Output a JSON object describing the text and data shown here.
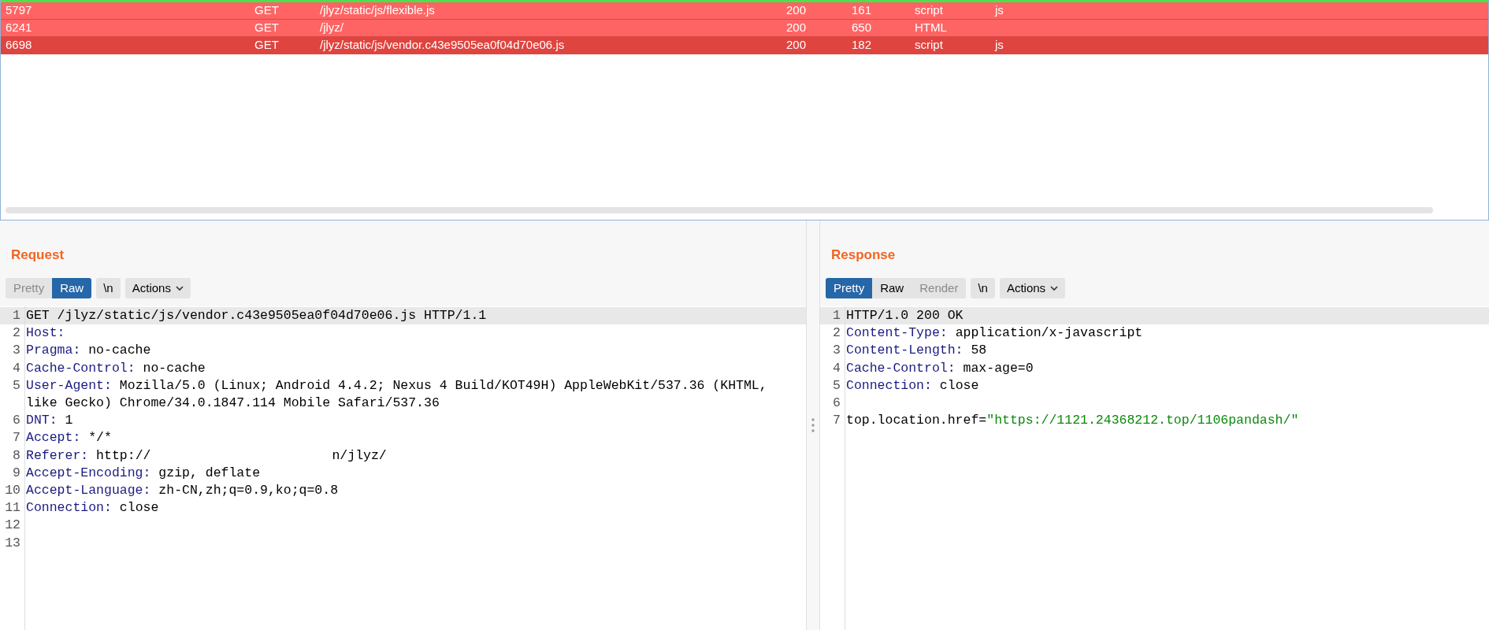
{
  "history": {
    "rows": [
      {
        "id": "5797",
        "method": "GET",
        "path": "/jlyz/static/js/flexible.js",
        "status": "200",
        "length": "161",
        "mime": "script",
        "extension": "js",
        "selected": false
      },
      {
        "id": "6241",
        "method": "GET",
        "path": "/jlyz/",
        "status": "200",
        "length": "650",
        "mime": "HTML",
        "selected": false
      },
      {
        "id": "6698",
        "method": "GET",
        "path": "/jlyz/static/js/vendor.c43e9505ea0f04d70e06.js",
        "status": "200",
        "length": "182",
        "mime": "script",
        "extension": "js",
        "selected": true
      }
    ]
  },
  "request": {
    "title": "Request",
    "tabs": [
      {
        "label": "Pretty",
        "selected": false,
        "disabled": true
      },
      {
        "label": "Raw",
        "selected": true,
        "disabled": false
      }
    ],
    "newline_button": "\\n",
    "actions_button": "Actions",
    "lines": [
      {
        "number": "1",
        "kind": "plain",
        "text": "GET /jlyz/static/js/vendor.c43e9505ea0f04d70e06.js HTTP/1.1"
      },
      {
        "number": "2",
        "kind": "header",
        "key": "Host:"
      },
      {
        "number": "3",
        "kind": "header",
        "key": "Pragma:",
        "value": "no-cache"
      },
      {
        "number": "4",
        "kind": "header",
        "key": "Cache-Control:",
        "value": "no-cache"
      },
      {
        "number": "5",
        "kind": "header",
        "key": "User-Agent:",
        "value": "Mozilla/5.0 (Linux; Android 4.4.2; Nexus 4 Build/KOT49H) AppleWebKit/537.36 (KHTML, like Gecko) Chrome/34.0.1847.114 Mobile Safari/537.36"
      },
      {
        "number": "6",
        "kind": "header",
        "key": "DNT:",
        "value": "1"
      },
      {
        "number": "7",
        "kind": "header",
        "key": "Accept:",
        "value": "*/*"
      },
      {
        "number": "8",
        "kind": "header",
        "key": "Referer:",
        "value": "http://",
        "tail": "n/jlyz/"
      },
      {
        "number": "9",
        "kind": "header",
        "key": "Accept-Encoding:",
        "value": "gzip, deflate"
      },
      {
        "number": "10",
        "kind": "header",
        "key": "Accept-Language:",
        "value": "zh-CN,zh;q=0.9,ko;q=0.8"
      },
      {
        "number": "11",
        "kind": "header",
        "key": "Connection:",
        "value": "close"
      },
      {
        "number": "12",
        "kind": "blank"
      },
      {
        "number": "13",
        "kind": "blank"
      }
    ]
  },
  "response": {
    "title": "Response",
    "tabs": [
      {
        "label": "Pretty",
        "selected": true,
        "disabled": false
      },
      {
        "label": "Raw",
        "selected": false,
        "disabled": false
      },
      {
        "label": "Render",
        "selected": false,
        "disabled": true
      }
    ],
    "newline_button": "\\n",
    "actions_button": "Actions",
    "lines": [
      {
        "number": "1",
        "kind": "plain",
        "text": "HTTP/1.0 200 OK"
      },
      {
        "number": "2",
        "kind": "header",
        "key": "Content-Type:",
        "value": "application/x-javascript"
      },
      {
        "number": "3",
        "kind": "header",
        "key": "Content-Length:",
        "value": "58"
      },
      {
        "number": "4",
        "kind": "header",
        "key": "Cache-Control:",
        "value": "max-age=0"
      },
      {
        "number": "5",
        "kind": "header",
        "key": "Connection:",
        "value": "close"
      },
      {
        "number": "6",
        "kind": "blank"
      },
      {
        "number": "7",
        "kind": "script",
        "text": "top.location.href=",
        "string": "\"https://1121.24368212.top/1106pandash/\""
      }
    ]
  }
}
